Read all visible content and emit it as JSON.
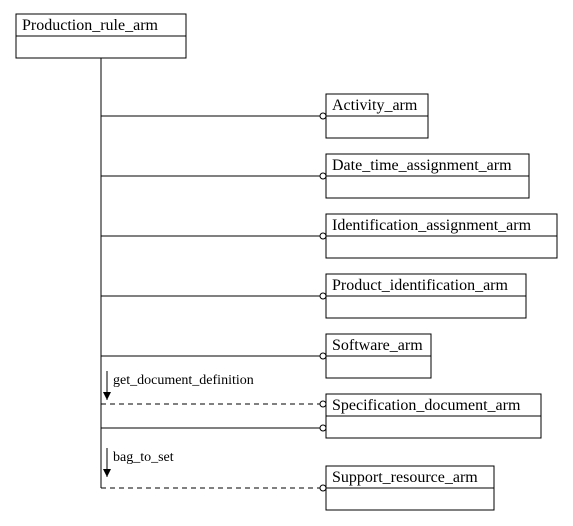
{
  "diagram": {
    "rootModule": "Production_rule_arm",
    "childModules": [
      "Activity_arm",
      "Date_time_assignment_arm",
      "Identification_assignment_arm",
      "Product_identification_arm",
      "Software_arm",
      "Specification_document_arm",
      "Support_resource_arm"
    ],
    "referenceLabels": [
      "get_document_definition",
      "bag_to_set"
    ],
    "chart_data": {
      "type": "diagram",
      "title": "EXPRESS-G module dependency diagram",
      "root": "Production_rule_arm",
      "uses": [
        {
          "target": "Activity_arm",
          "kind": "use"
        },
        {
          "target": "Date_time_assignment_arm",
          "kind": "use"
        },
        {
          "target": "Identification_assignment_arm",
          "kind": "use"
        },
        {
          "target": "Product_identification_arm",
          "kind": "use"
        },
        {
          "target": "Software_arm",
          "kind": "use"
        },
        {
          "target": "Specification_document_arm",
          "kind": "reference",
          "items": [
            "get_document_definition"
          ]
        },
        {
          "target": "Support_resource_arm",
          "kind": "reference",
          "items": [
            "bag_to_set"
          ]
        }
      ]
    }
  }
}
